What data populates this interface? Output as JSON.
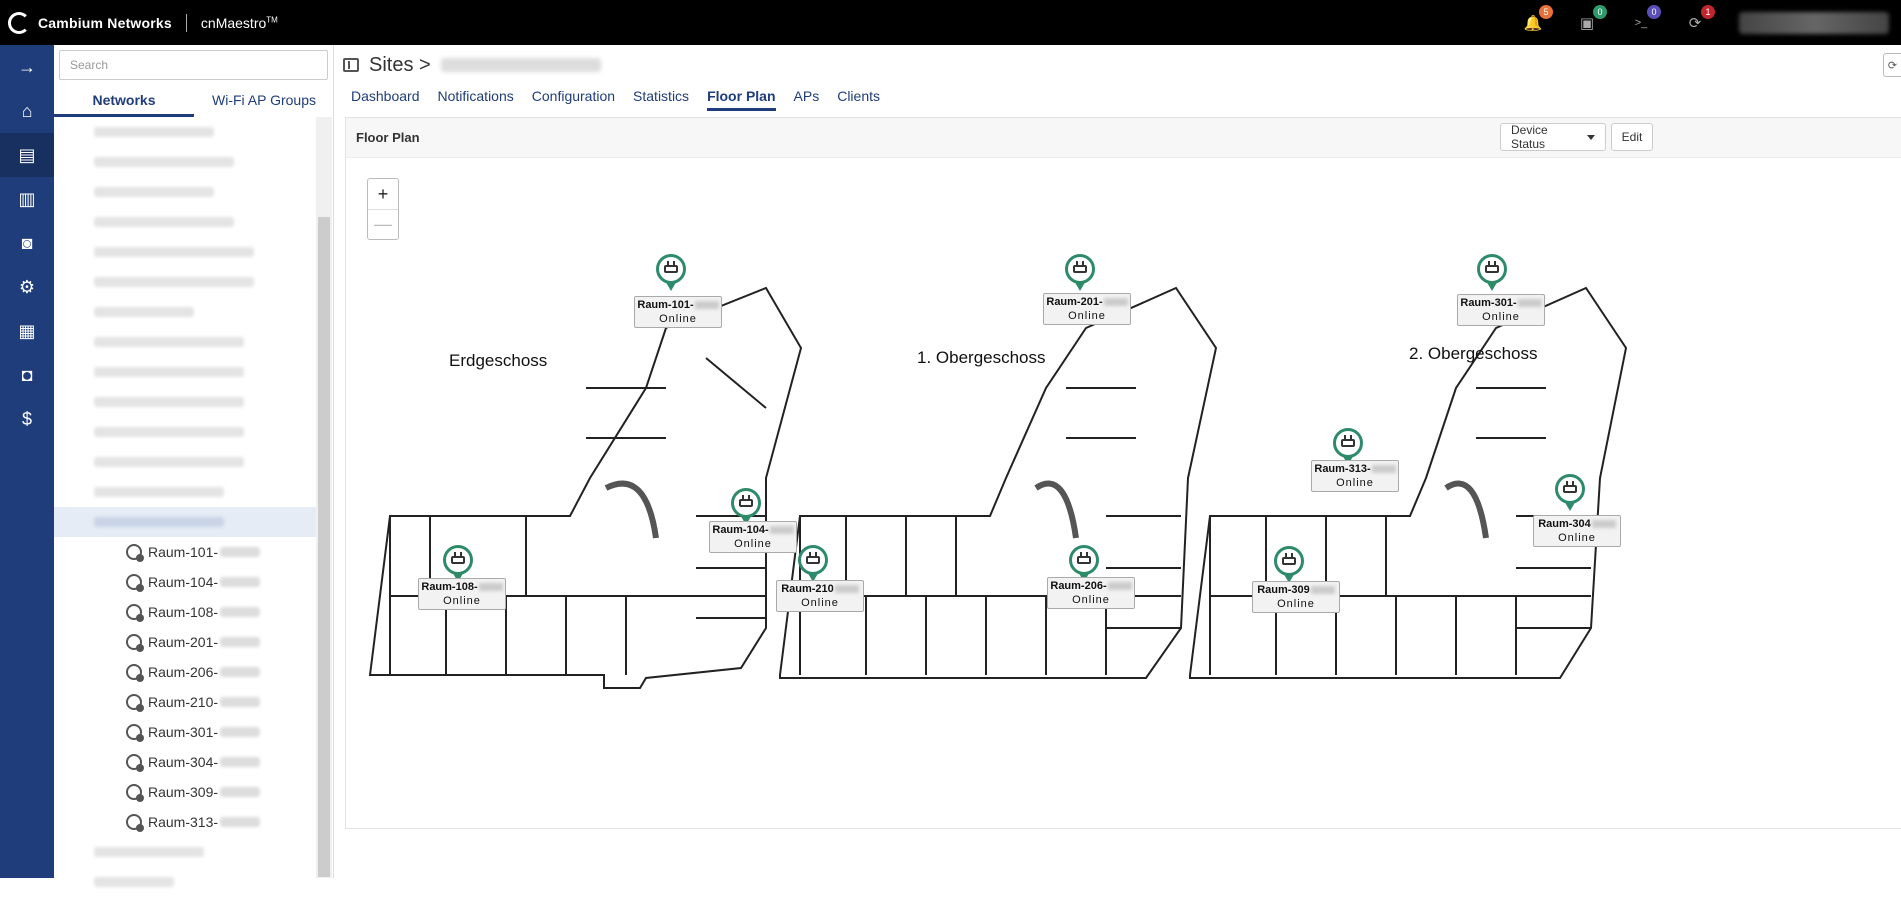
{
  "topbar": {
    "brand": "Cambium Networks",
    "product": "cnMaestro",
    "trademark": "TM",
    "icons": [
      {
        "name": "bell-icon",
        "glyph": "🔔",
        "badge": "5",
        "color": "#e8703a"
      },
      {
        "name": "camera-icon",
        "glyph": "▣",
        "badge": "0",
        "color": "#2e9a6a"
      },
      {
        "name": "terminal-icon",
        "glyph": ">_",
        "badge": "0",
        "color": "#5a4fb8"
      },
      {
        "name": "sync-icon",
        "glyph": "⟳",
        "badge": "1",
        "color": "#c0252b"
      }
    ]
  },
  "leftnav": [
    {
      "name": "expand-arrow-icon",
      "glyph": "→"
    },
    {
      "name": "home-icon",
      "glyph": "⌂"
    },
    {
      "name": "monitor-icon",
      "glyph": "▤"
    },
    {
      "name": "document-icon",
      "glyph": "▥"
    },
    {
      "name": "camera-nav-icon",
      "glyph": "◙"
    },
    {
      "name": "settings-icon",
      "glyph": "⚙"
    },
    {
      "name": "apps-icon",
      "glyph": "▦"
    },
    {
      "name": "admin-icon",
      "glyph": "◘"
    },
    {
      "name": "license-icon",
      "glyph": "$"
    }
  ],
  "tree": {
    "search_placeholder": "Search",
    "tabs": [
      "Networks",
      "Wi-Fi AP Groups"
    ],
    "aps": [
      "Raum-101-",
      "Raum-104-",
      "Raum-108-",
      "Raum-201-",
      "Raum-206-",
      "Raum-210-",
      "Raum-301-",
      "Raum-304-",
      "Raum-309-",
      "Raum-313-"
    ]
  },
  "main": {
    "title": "Sites >",
    "tabs": [
      "Dashboard",
      "Notifications",
      "Configuration",
      "Statistics",
      "Floor Plan",
      "APs",
      "Clients"
    ],
    "active_tab": "Floor Plan",
    "card_title": "Floor Plan",
    "device_status_label": "Device Status",
    "edit_label": "Edit",
    "zoom_in": "+",
    "zoom_out": "—"
  },
  "floors": [
    "Erdgeschoss",
    "1. Obergeschoss",
    "2. Obergeschoss"
  ],
  "markers": [
    {
      "name": "Raum-101-",
      "status": "Online"
    },
    {
      "name": "Raum-104-",
      "status": "Online"
    },
    {
      "name": "Raum-108-",
      "status": "Online"
    },
    {
      "name": "Raum-201-",
      "status": "Online"
    },
    {
      "name": "Raum-210",
      "status": "Online"
    },
    {
      "name": "Raum-206-",
      "status": "Online"
    },
    {
      "name": "Raum-301-",
      "status": "Online"
    },
    {
      "name": "Raum-313-",
      "status": "Online"
    },
    {
      "name": "Raum-304",
      "status": "Online"
    },
    {
      "name": "Raum-309",
      "status": "Online"
    }
  ]
}
